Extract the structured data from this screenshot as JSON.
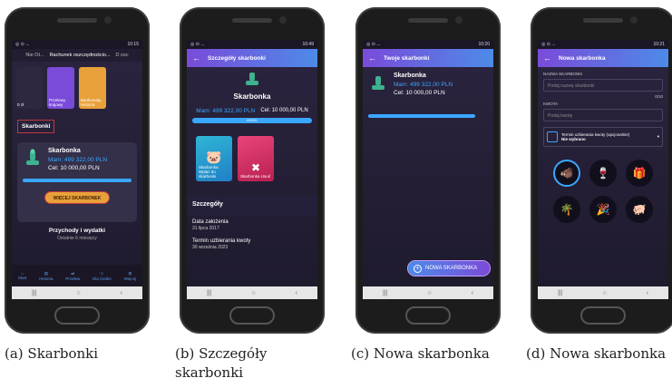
{
  "screens": {
    "a": {
      "status_time": "10:15",
      "header": "Rachunek oszczędnościo...",
      "left_tab": "Nie Ot...",
      "right_tab": "D osc",
      "tiles": [
        {
          "label": "0 zł"
        },
        {
          "label": "Przelewy krajowy"
        },
        {
          "label": "Bankomaty Historia"
        }
      ],
      "section_title": "Skarbonki",
      "card": {
        "name": "Skarbonka",
        "have": "Mam: 499 322,00 PLN",
        "goal": "Cel: 10 000,00 PLN"
      },
      "more_button": "WIĘCEJ SKARBONEK",
      "income_title": "Przychody i wydatki",
      "income_sub": "Ostatnie 6 miesięcy",
      "nav": [
        "Start",
        "Historia",
        "Przelew",
        "Dla Ciebie",
        "Więcej"
      ]
    },
    "b": {
      "status_time": "10:49",
      "title": "Szczegóły skarbonki",
      "name": "Skarbonka",
      "have": "Mam: 499 322,00 PLN",
      "goal": "Cel: 10 000,00 PLN",
      "pill": "499322,",
      "tiles": [
        {
          "caption": "Skarbonka Wpłać do skarbonki"
        },
        {
          "caption": "Skarbonka Usuń"
        }
      ],
      "details_title": "Szczegóły",
      "created_label": "Data założenia",
      "created_value": "31 lipca 2017",
      "due_label": "Termin uzbierania kwoty",
      "due_value": "30 września 2023"
    },
    "c": {
      "status_time": "10:20",
      "title": "Twoje skarbonki",
      "card": {
        "name": "Skarbonka",
        "have": "Mam: 499 322,00 PLN",
        "goal": "Cel: 10 000,00 PLN"
      },
      "new_button": "NOWA SKARBONKA"
    },
    "d": {
      "status_time": "10:21",
      "title": "Nowa skarbonka",
      "name_label": "NAZWA SKARBONKI",
      "name_placeholder": "Podaj nazwę skarbonki",
      "counter": "0/10",
      "amount_label": "KWOTA",
      "amount_placeholder": "Podaj kwotę",
      "date_label": "Termin uzbierania kwoty (opcjonalnie)",
      "date_value": "Nie wybrano"
    }
  },
  "captions": {
    "a": "(a) Skarbonki",
    "b": "(b) Szczegóły skarbonki",
    "c": "(c) Nowa skarbonka",
    "d": "(d) Nowa skarbonka"
  },
  "colors": {
    "accent": "#3aa7ff",
    "button": "#e8a13a",
    "appbar_start": "#7a4bd9",
    "appbar_end": "#4d8be8"
  }
}
